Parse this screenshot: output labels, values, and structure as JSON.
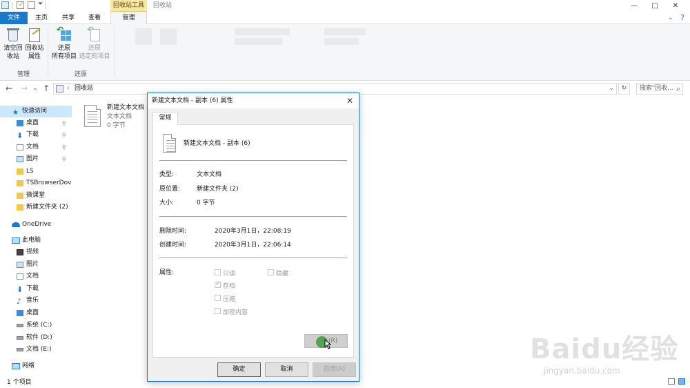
{
  "titlebar": {
    "context_tab": "回收站工具",
    "window_title": "回收站",
    "minimize": "—",
    "maximize": "□",
    "close": "✕"
  },
  "tabs": {
    "file": "文件",
    "home": "主页",
    "share": "共享",
    "view": "查看",
    "manage": "管理",
    "help": "?"
  },
  "ribbon": {
    "empty_bin_line1": "清空回",
    "empty_bin_line2": "收站",
    "properties_line1": "回收站",
    "properties_line2": "属性",
    "restore_all_line1": "还原",
    "restore_all_line2": "所有项目",
    "restore_selected_line1": "还原",
    "restore_selected_line2": "选定的项目",
    "group_manage": "管理",
    "group_restore": "还原"
  },
  "address": {
    "back": "←",
    "forward": "→",
    "recent": "⌄",
    "up": "↑",
    "path_sep": "›",
    "path": "回收站",
    "dropdown": "⌄",
    "refresh": "↻",
    "search_placeholder": "搜索\"回收...",
    "search_icon": "⌕"
  },
  "nav": {
    "quick_access": "快速访问",
    "desktop": "桌面",
    "downloads": "下载",
    "documents": "文档",
    "pictures": "图片",
    "ls": "LS",
    "tsbrowser": "TSBrowserDov",
    "weiketang": "微课堂",
    "new_folder": "新建文件夹 (2)",
    "onedrive": "OneDrive",
    "this_pc": "此电脑",
    "videos": "视频",
    "pc_pictures": "图片",
    "pc_documents": "文档",
    "pc_downloads": "下载",
    "music": "音乐",
    "pc_desktop": "桌面",
    "drive_c": "系统 (C:)",
    "drive_d": "软件 (D:)",
    "drive_e": "文档 (E:)",
    "network": "网络",
    "pin": "📌"
  },
  "content": {
    "file_name": "新建文本文档 -",
    "file_type": "文本文档",
    "file_size": "0 字节"
  },
  "status": {
    "count": "1 个项目"
  },
  "dialog": {
    "title": "新建文本文档 - 副本 (6) 属性",
    "close": "✕",
    "tab_general": "常规",
    "file_name": "新建文本文档 - 副本 (6)",
    "type_label": "类型:",
    "type_value": "文本文档",
    "location_label": "原位置:",
    "location_value": "新建文件夹 (2)",
    "size_label": "大小:",
    "size_value": "0 字节",
    "deleted_label": "删除时间:",
    "deleted_value": "2020年3月1日，22:08:19",
    "created_label": "创建时间:",
    "created_value": "2020年3月1日，22:06:14",
    "attributes_label": "属性:",
    "attr_readonly": "只读",
    "attr_hidden": "隐藏",
    "attr_archive": "存档",
    "attr_compress": "压缩",
    "attr_encrypt": "加密内容",
    "advanced_button": "(R)",
    "ok_button": "确定",
    "cancel_button": "取消",
    "apply_button": "应用(A)"
  },
  "watermark": {
    "logo": "Baidu经验",
    "url": "jingyan.baidu.com"
  }
}
